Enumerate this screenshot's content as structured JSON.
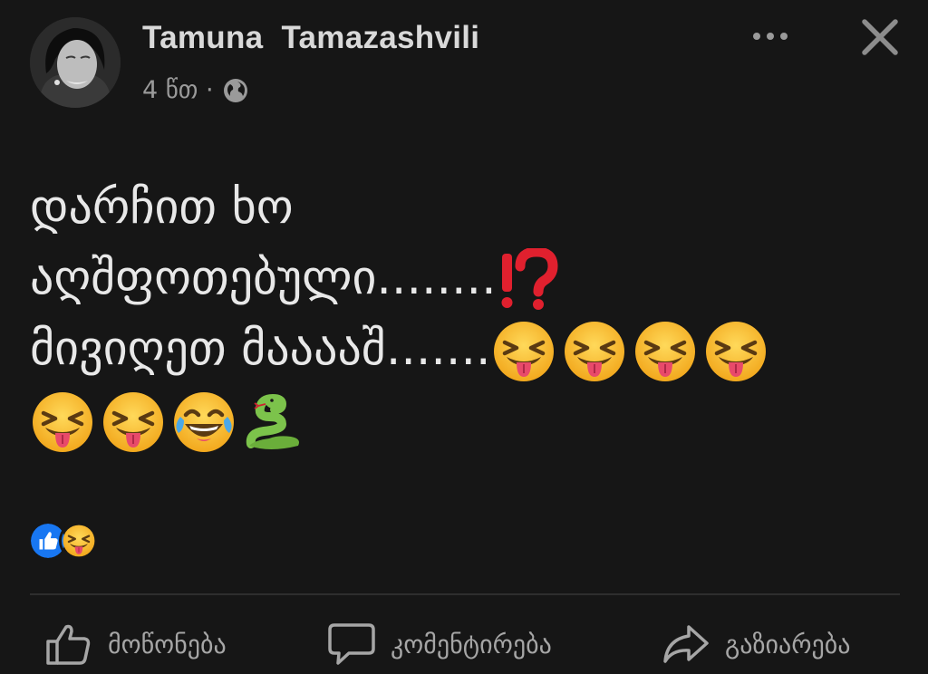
{
  "post": {
    "author": "Tamuna  Tamazashvili",
    "time": "4 წთ ·",
    "privacy_icon": "globe-icon",
    "text_lines": [
      "დარჩით ხო",
      "აღშფოთებული........",
      "მივიღეთ მააააშ.......",
      ""
    ],
    "emojis": {
      "line2": [
        "interrobang"
      ],
      "line3": [
        "squinting-face-with-tongue",
        "squinting-face-with-tongue",
        "squinting-face-with-tongue",
        "squinting-face-with-tongue"
      ],
      "line4": [
        "squinting-face-with-tongue",
        "squinting-face-with-tongue",
        "face-with-tears-of-joy",
        "snake"
      ]
    }
  },
  "reactions": [
    "like-reaction",
    "haha-reaction"
  ],
  "actions": {
    "like": "მოწონება",
    "comment": "კომენტირება",
    "share": "გაზიარება"
  },
  "colors": {
    "background": "#161616",
    "text": "#e8e8e8",
    "muted": "#9a9a9a",
    "like_blue": "#1877f2",
    "emoji_yellow": "#f7c23a",
    "snake_green": "#7cc34b",
    "interrobang_red": "#e0202e"
  }
}
